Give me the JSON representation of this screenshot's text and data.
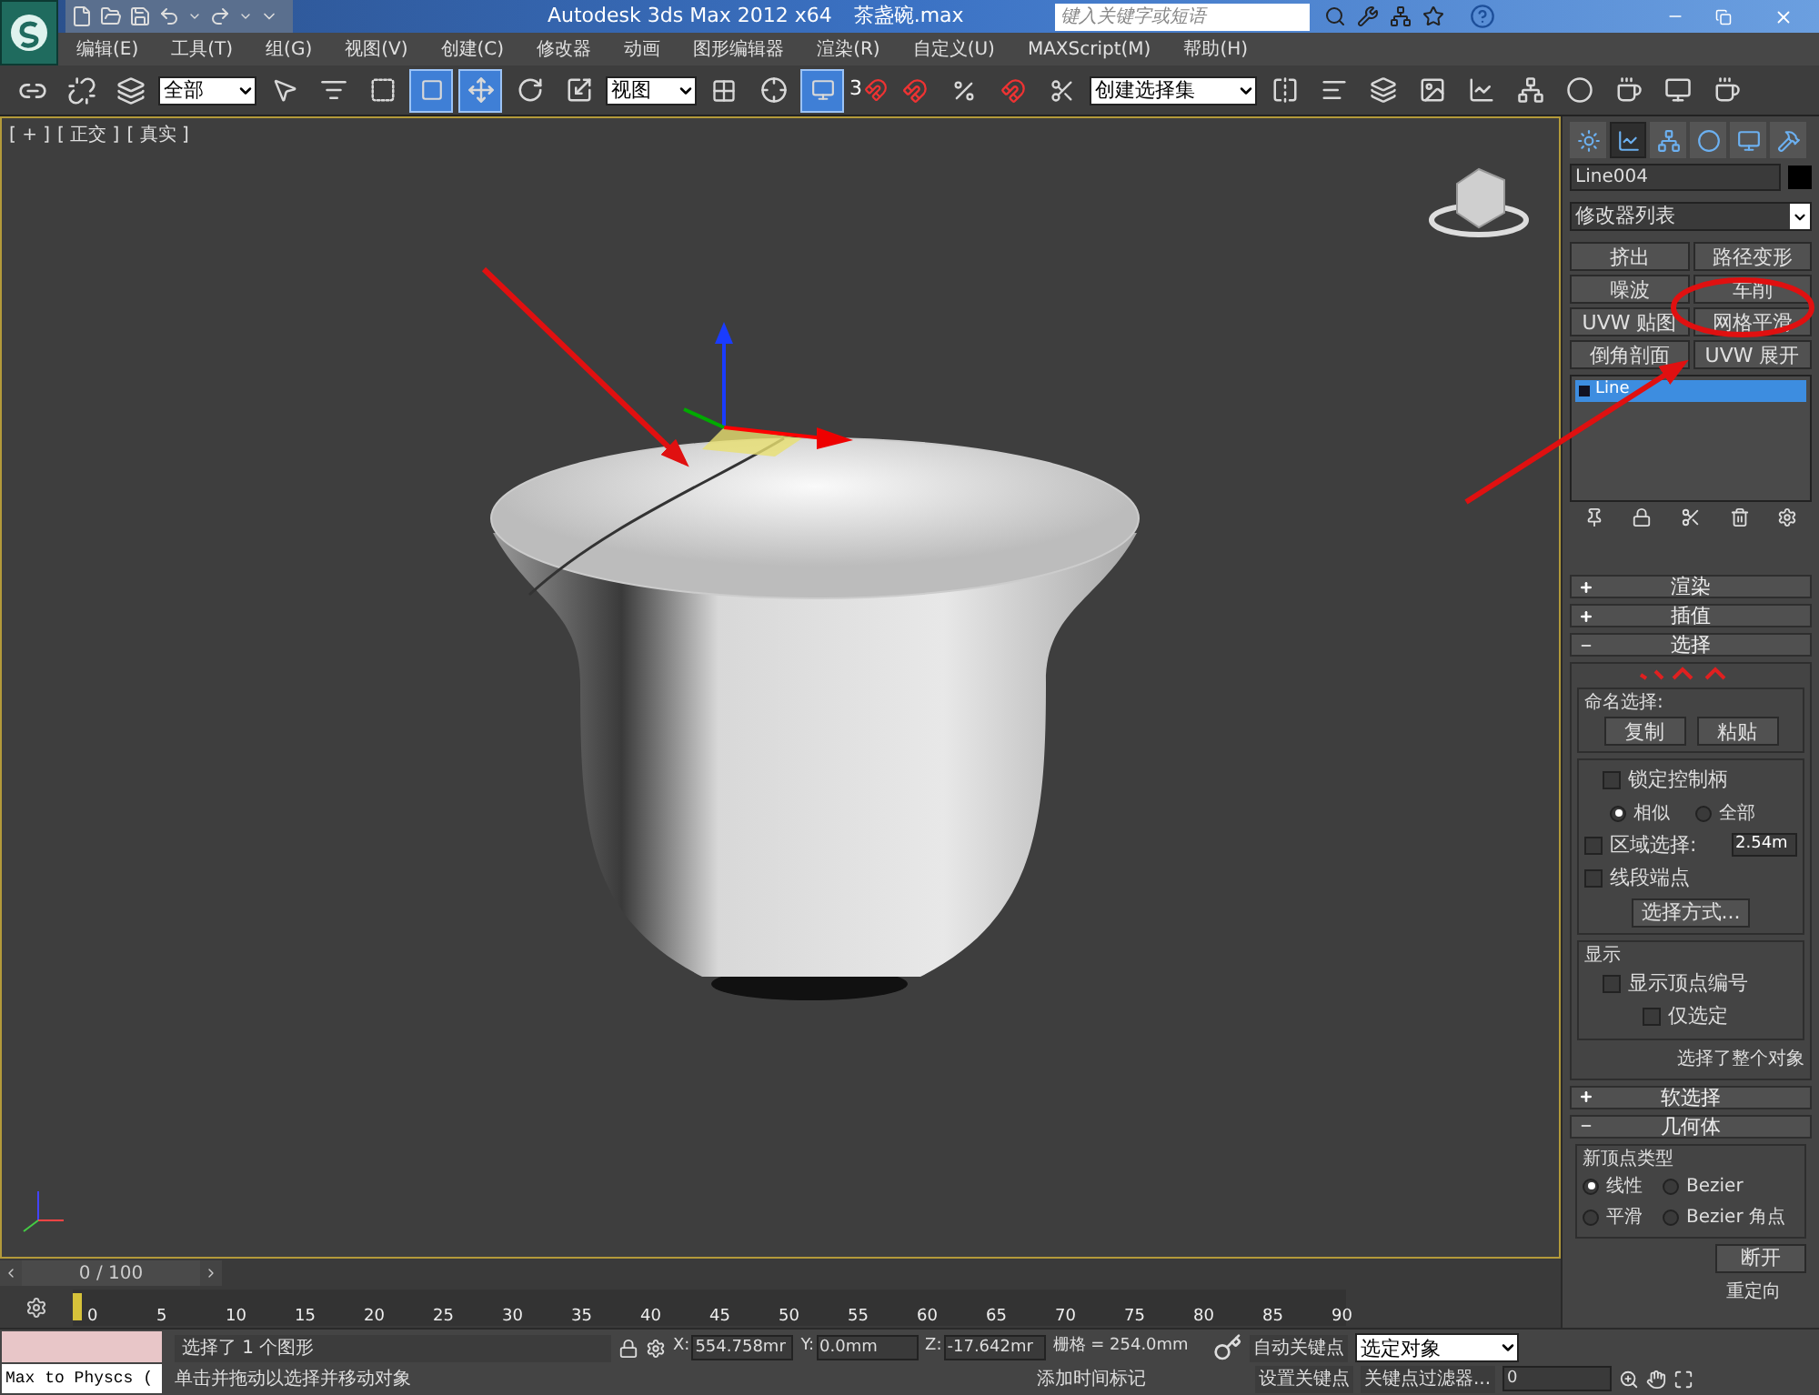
{
  "title_bar": {
    "title": "Autodesk 3ds Max  2012 x64",
    "file": "茶盏碗.max",
    "search": {
      "placeholder": "键入关键字或短语"
    }
  },
  "menu": [
    "编辑(E)",
    "工具(T)",
    "组(G)",
    "视图(V)",
    "创建(C)",
    "修改器",
    "动画",
    "图形编辑器",
    "渲染(R)",
    "自定义(U)",
    "MAXScript(M)",
    "帮助(H)"
  ],
  "toolbar": {
    "selection_filter": "全部",
    "window_crossing": {
      "on": true
    },
    "move": {
      "selected": true
    },
    "reference_coord": "视图",
    "keyboard_override": {
      "on": true
    },
    "snap_dimension": "3",
    "named_selection": "创建选择集"
  },
  "viewport": {
    "labels": [
      "[ + ]",
      "[ 正交 ]",
      "[ 真实 ]"
    ]
  },
  "command_panel": {
    "tabs": [
      {
        "selected": false
      },
      {
        "selected": true
      },
      {
        "selected": false
      },
      {
        "selected": false
      },
      {
        "selected": false
      },
      {
        "selected": false
      }
    ],
    "object_name": "Line004",
    "modifier_list": "修改器列表",
    "modifier_buttons": [
      "挤出",
      "路径变形",
      "噪波",
      "车削",
      "UVW 贴图",
      "网格平滑",
      "倒角剖面",
      "UVW 展开"
    ],
    "stack": [
      {
        "label": "Line",
        "selected": true
      }
    ],
    "rollouts": [
      {
        "title": "渲染",
        "expanded": false
      },
      {
        "title": "插值",
        "expanded": false
      },
      {
        "title": "选择",
        "expanded": true
      },
      {
        "title": "软选择",
        "expanded": false
      },
      {
        "title": "几何体",
        "expanded": true
      }
    ],
    "selection": {
      "named_selection": {
        "label": "命名选择:",
        "buttons": [
          "复制",
          "粘贴"
        ]
      },
      "lock_handles": {
        "label": "锁定控制柄",
        "checked": false
      },
      "handle_mode": [
        {
          "label": "相似",
          "selected": true
        },
        {
          "label": "全部",
          "selected": false
        }
      ],
      "area_selection": {
        "label": "区域选择:",
        "checked": false,
        "value": "2.54m"
      },
      "segment_end": {
        "label": "线段端点",
        "checked": false
      },
      "select_by": "选择方式...",
      "display": {
        "label": "显示",
        "show_vertex_numbers": {
          "label": "显示顶点编号",
          "checked": false
        },
        "selected_only": {
          "label": "仅选定",
          "checked": false
        }
      },
      "status": "选择了整个对象"
    },
    "geometry": {
      "new_vertex_type": {
        "label": "新顶点类型",
        "options": [
          {
            "label": "线性",
            "selected": true
          },
          {
            "label": "Bezier",
            "selected": false
          },
          {
            "label": "平滑",
            "selected": false
          },
          {
            "label": "Bezier 角点",
            "selected": false
          }
        ]
      },
      "break_button": "断开",
      "reorient": "重定向"
    }
  },
  "time_slider": {
    "label": "0 / 100",
    "level": 0
  },
  "ruler_ticks": [
    "0",
    "5",
    "10",
    "15",
    "20",
    "25",
    "30",
    "35",
    "40",
    "45",
    "50",
    "55",
    "60",
    "65",
    "70",
    "75",
    "80",
    "85",
    "90"
  ],
  "listener": {
    "text": "Max to Physcs ("
  },
  "status_bar": {
    "prompt": "选择了 1 个图形",
    "hint": "单击并拖动以选择并移动对象",
    "coordinates": [
      {
        "axis": "X:",
        "value": "554.758mr"
      },
      {
        "axis": "Y:",
        "value": "0.0mm"
      },
      {
        "axis": "Z:",
        "value": "-17.642mr"
      }
    ],
    "grid": "栅格 = 254.0mm",
    "add_time_tag": "添加时间标记",
    "auto_key": "自动关键点",
    "set_key": "设置关键点",
    "key_mode": "选定对象",
    "key_filters": "关键点过滤器...",
    "frame": "0"
  }
}
